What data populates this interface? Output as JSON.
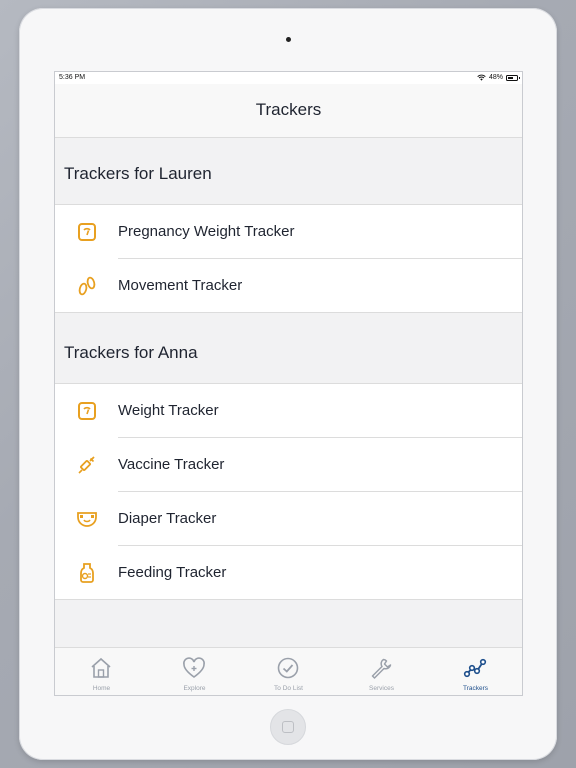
{
  "status_bar": {
    "time": "5:36 PM",
    "battery": "48%"
  },
  "nav": {
    "title": "Trackers"
  },
  "sections": [
    {
      "title": "Trackers for Lauren",
      "items": [
        {
          "label": "Pregnancy Weight Tracker",
          "icon": "scale-icon"
        },
        {
          "label": "Movement Tracker",
          "icon": "footprints-icon"
        }
      ]
    },
    {
      "title": "Trackers for Anna",
      "items": [
        {
          "label": "Weight Tracker",
          "icon": "scale-icon"
        },
        {
          "label": "Vaccine Tracker",
          "icon": "syringe-icon"
        },
        {
          "label": "Diaper Tracker",
          "icon": "diaper-icon"
        },
        {
          "label": "Feeding Tracker",
          "icon": "bottle-icon"
        }
      ]
    }
  ],
  "tabs": [
    {
      "label": "Home",
      "icon": "house-icon",
      "active": false
    },
    {
      "label": "Explore",
      "icon": "heart-plus-icon",
      "active": false
    },
    {
      "label": "To Do List",
      "icon": "check-circle-icon",
      "active": false
    },
    {
      "label": "Services",
      "icon": "wrench-icon",
      "active": false
    },
    {
      "label": "Trackers",
      "icon": "chart-line-icon",
      "active": true
    }
  ],
  "colors": {
    "accent_orange": "#e8a020",
    "active_blue": "#1e4f8c",
    "inactive_gray": "#9aa0aa"
  }
}
